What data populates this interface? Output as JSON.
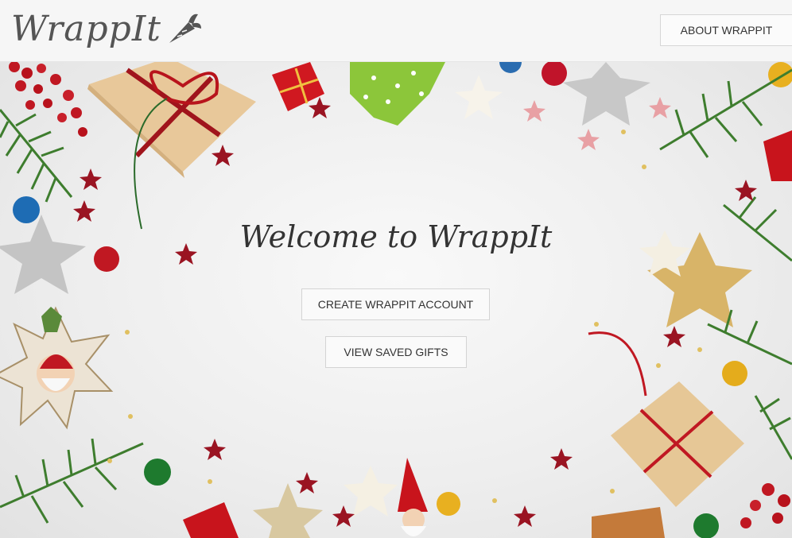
{
  "header": {
    "logo_text": "WrappIt",
    "logo_icon": "carrot-icon",
    "about_label": "ABOUT WRAPPIT"
  },
  "hero": {
    "title": "Welcome to WrappIt",
    "create_account_label": "CREATE WRAPPIT ACCOUNT",
    "saved_gifts_label": "VIEW SAVED GIFTS"
  },
  "colors": {
    "header_bg": "#f6f6f6",
    "text": "#333333",
    "logo": "#555555",
    "kraft_gift": "#e8c89a",
    "ribbon_red": "#c0202a",
    "pine_green": "#3e7d2e"
  }
}
